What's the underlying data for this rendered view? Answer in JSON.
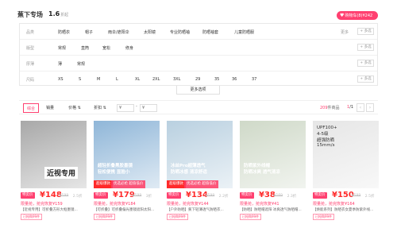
{
  "header": {
    "title": "蕉下专场",
    "count": "1.6",
    "count_unit": "折起",
    "cart_button": "购物车(8)¥242"
  },
  "filters": [
    {
      "label": "品类",
      "options": [
        "防晒衣",
        "帽子",
        "雨伞/遮阳伞",
        "太阳镜",
        "专业防晒袖",
        "防晒袖套",
        "儿童防晒服"
      ]
    },
    {
      "label": "版型",
      "options": [
        "常规",
        "直筒",
        "宽松",
        "修身"
      ]
    },
    {
      "label": "厚薄",
      "options": [
        "薄",
        "常规"
      ]
    },
    {
      "label": "尺码",
      "options": [
        "XS",
        "S",
        "M",
        "L",
        "XL",
        "2XL",
        "3XL",
        "29",
        "35",
        "36",
        "37"
      ]
    }
  ],
  "filter_more": "更多",
  "filter_multi": "+ 多选",
  "more_options": "更多选项",
  "sort": {
    "tabs": [
      "综合",
      "销量",
      "价格",
      "折扣"
    ],
    "price_min_placeholder": "¥",
    "price_max_placeholder": "¥",
    "price_sep": "-",
    "result_count_num": "209",
    "result_count_label": "件商品",
    "page_current": "1",
    "page_total": "/1",
    "prev": "‹",
    "next": "›"
  },
  "products": [
    {
      "image_text": "近视专用",
      "top_tag": "",
      "hot": "",
      "hot_tag": "",
      "price_badge": "特卖价",
      "price": "¥148",
      "orig_price": "¥599",
      "discount": "2.5折",
      "promo": "限量抢，抢完恢复¥159",
      "desc": "【近视专用】可折叠方形大框墨镜...",
      "tag": "已抢购99件",
      "bg": "#a8a8a8"
    },
    {
      "image_text": "超轻折叠黑胶墨镜\n轻松便携 显脸小",
      "top_tag": "",
      "hot": "超级爆款",
      "hot_tag": "优选必抢 超值低价",
      "price_badge": "特卖价",
      "price": "¥179",
      "orig_price": "¥599",
      "discount": "3折",
      "promo": "限量抢，抢完恢复¥184",
      "desc": "【可折叠】可折叠偏光墨镜遮阳太阳...",
      "tag": "已抢购99件",
      "bg": "#8fb6d8"
    },
    {
      "image_text": "冰丝Pro超薄透气\n防晒冰感 清凉舒适",
      "top_tag": "",
      "hot": "超级爆款",
      "hot_tag": "优选必抢 超值低价",
      "price_badge": "特卖价",
      "price": "¥134",
      "orig_price": "¥599",
      "discount": "2.2折",
      "promo": "限量抢，抢完恢复¥144",
      "desc": "【户外防晒】蕉下轻薄透气防晒衣...",
      "tag": "已抢购99件",
      "bg": "#b9d0e0"
    },
    {
      "image_text": "防晒紫外线帽\n防晒冰爽 透气清凉",
      "top_tag": "",
      "hot": "",
      "hot_tag": "",
      "price_badge": "特卖价",
      "price": "¥38",
      "orig_price": "¥169",
      "discount": "2.3折",
      "promo": "限量抢，抢完恢复¥41",
      "desc": "【防晒】防晒帽遮阳 冰爽透气防晒帽...",
      "tag": "已抢购99件",
      "bg": "#cfd9c8"
    },
    {
      "image_text": "UPF100+\n4-5级\n超强防晒\n15mm/s",
      "top_tag": "",
      "hot": "",
      "hot_tag": "",
      "price_badge": "特卖价",
      "price": "¥150",
      "orig_price": "¥599",
      "discount": "2.5折",
      "promo": "限量抢，抢完恢复¥164",
      "desc": "【焕能系列】防晒衣女夏季防紫外线...",
      "tag": "已抢购99件",
      "bg": "#e6e6e6"
    }
  ]
}
